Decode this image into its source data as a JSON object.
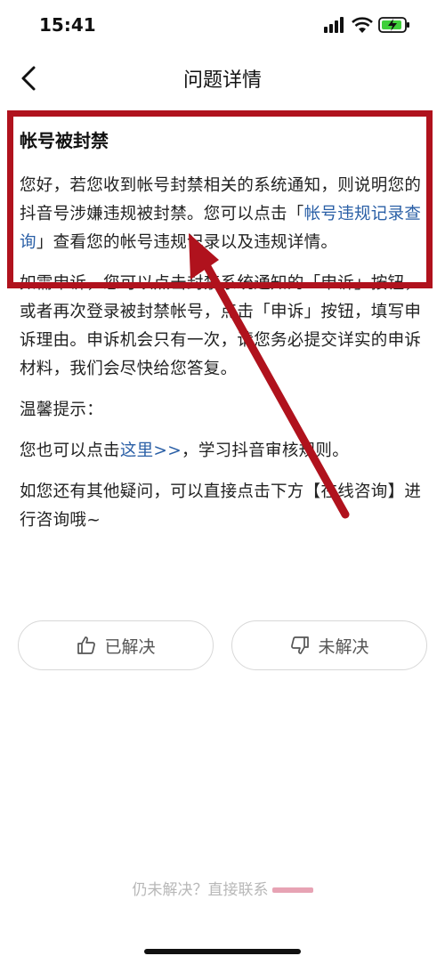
{
  "status_bar": {
    "time": "15:41",
    "icons": [
      "signal-icon",
      "wifi-icon",
      "battery-charging-icon"
    ],
    "battery_color": "#3fcf3a"
  },
  "nav": {
    "back_icon": "chevron-left-icon",
    "title": "问题详情"
  },
  "article": {
    "title": "帐号被封禁",
    "p1_a": "您好，若您收到帐号封禁相关的系统通知，则说明您的抖音号涉嫌违规被封禁。您可以点击「",
    "p1_link": "帐号违规记录查询",
    "p1_b": "」查看您的帐号违规记录以及违规详情。",
    "p2": "如需申诉，您可以点击封禁系统通知的「申诉」按钮，或者再次登录被封禁帐号，点击「申诉」按钮，填写申诉理由。申诉机会只有一次，请您务必提交详实的申诉材料，我们会尽快给您答复。",
    "p3": "温馨提示：",
    "p4_a": "您也可以点击",
    "p4_link": "这里>>",
    "p4_b": "，学习抖音审核规则。",
    "p5": "如您还有其他疑问，可以直接点击下方【在线咨询】进行咨询哦~"
  },
  "feedback": {
    "resolved_label": "已解决",
    "resolved_icon": "thumbs-up-icon",
    "unresolved_label": "未解决",
    "unresolved_icon": "thumbs-down-icon"
  },
  "footer": {
    "note": "仍未解决？直接联系"
  },
  "annotation": {
    "color": "#b0121d"
  }
}
